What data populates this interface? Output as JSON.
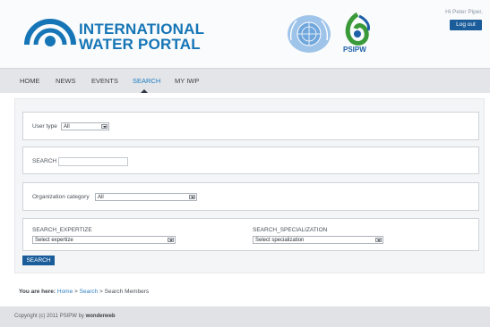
{
  "header": {
    "logo_line1": "INTERNATIONAL",
    "logo_line2": "WATER PORTAL",
    "psipw_label": "PSIPW",
    "greeting": "Hi Peter Piper,",
    "logout_label": "Log out",
    "brand_color": "#1575b6",
    "logo_icon": "water-drop-icon",
    "un_icon": "un-emblem-icon",
    "psipw_icon": "psipw-logo-icon"
  },
  "nav": {
    "items": [
      {
        "label": "HOME"
      },
      {
        "label": "NEWS"
      },
      {
        "label": "EVENTS"
      },
      {
        "label": "SEARCH",
        "active": true
      },
      {
        "label": "MY IWP"
      }
    ]
  },
  "search_form": {
    "user_type_label": "User type",
    "user_type_value": "All",
    "search_label": "SEARCH",
    "search_value": "",
    "org_category_label": "Organization category",
    "org_category_value": "All",
    "expertize_label": "SEARCH_EXPERTIZE",
    "expertize_value": "Select expertize",
    "specialization_label": "SEARCH_SPECIALIZATION",
    "specialization_value": "Select specialization",
    "submit_label": "SEARCH"
  },
  "breadcrumb": {
    "prefix": "You are here:",
    "home": "Home",
    "sep1": " > ",
    "search": "Search",
    "sep2": " > ",
    "current": "Search Members"
  },
  "footer": {
    "copyright": "Copyright (c) 2011 PSIPW by ",
    "company": "wonderweb"
  }
}
